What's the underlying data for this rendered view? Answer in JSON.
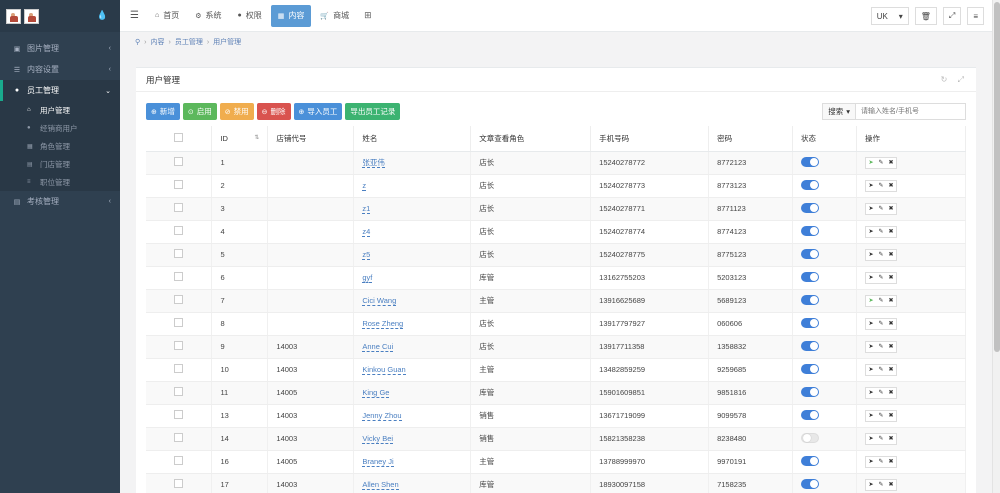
{
  "sidebar": {
    "items": [
      {
        "label": "图片管理",
        "icon": "image-icon"
      },
      {
        "label": "内容设置",
        "icon": "sliders-icon"
      },
      {
        "label": "员工管理",
        "icon": "user-icon"
      },
      {
        "label": "考核管理",
        "icon": "list-icon"
      }
    ],
    "sub_items": [
      {
        "label": "用户管理",
        "icon": "home-icon"
      },
      {
        "label": "经销商用户",
        "icon": "user-icon"
      },
      {
        "label": "角色管理",
        "icon": "th-icon"
      },
      {
        "label": "门店管理",
        "icon": "store-icon"
      },
      {
        "label": "职位管理",
        "icon": "list-icon"
      }
    ]
  },
  "topnav": {
    "tabs": [
      {
        "label": "首页",
        "icon": "home-icon"
      },
      {
        "label": "系统",
        "icon": "gear-icon"
      },
      {
        "label": "权限",
        "icon": "user-icon"
      },
      {
        "label": "内容",
        "icon": "table-icon"
      },
      {
        "label": "商城",
        "icon": "cart-icon"
      }
    ],
    "lang_label": "UK"
  },
  "breadcrumb": {
    "items": [
      "内容",
      "员工管理",
      "用户管理"
    ]
  },
  "panel": {
    "title": "用户管理"
  },
  "toolbar": {
    "add": "新增",
    "enable": "启用",
    "disable": "禁用",
    "delete": "删除",
    "import": "导入员工",
    "export": "导出员工记录"
  },
  "search": {
    "button": "搜索",
    "placeholder": "请输入姓名/手机号"
  },
  "table": {
    "columns": [
      "ID",
      "店铺代号",
      "姓名",
      "文章查看角色",
      "手机号码",
      "密码",
      "状态",
      "操作"
    ],
    "rows": [
      {
        "id": "1",
        "store": "",
        "name": "张亚伟",
        "role": "店长",
        "phone": "15240278772",
        "pwd": "8772123",
        "on": true,
        "send_active": true
      },
      {
        "id": "2",
        "store": "",
        "name": "z",
        "role": "店长",
        "phone": "15240278773",
        "pwd": "8773123",
        "on": true,
        "send_active": false
      },
      {
        "id": "3",
        "store": "",
        "name": "z1",
        "role": "店长",
        "phone": "15240278771",
        "pwd": "8771123",
        "on": true,
        "send_active": false
      },
      {
        "id": "4",
        "store": "",
        "name": "z4",
        "role": "店长",
        "phone": "15240278774",
        "pwd": "8774123",
        "on": true,
        "send_active": false
      },
      {
        "id": "5",
        "store": "",
        "name": "z5",
        "role": "店长",
        "phone": "15240278775",
        "pwd": "8775123",
        "on": true,
        "send_active": false
      },
      {
        "id": "6",
        "store": "",
        "name": "gyf",
        "role": "库管",
        "phone": "13162755203",
        "pwd": "5203123",
        "on": true,
        "send_active": false
      },
      {
        "id": "7",
        "store": "",
        "name": "Cici Wang",
        "role": "主管",
        "phone": "13916625689",
        "pwd": "5689123",
        "on": true,
        "send_active": true
      },
      {
        "id": "8",
        "store": "",
        "name": "Rose Zheng",
        "role": "店长",
        "phone": "13917797927",
        "pwd": "060606",
        "on": true,
        "send_active": false
      },
      {
        "id": "9",
        "store": "14003",
        "name": "Anne Cui",
        "role": "店长",
        "phone": "13917711358",
        "pwd": "1358832",
        "on": true,
        "send_active": false
      },
      {
        "id": "10",
        "store": "14003",
        "name": "Kinkou Guan",
        "role": "主管",
        "phone": "13482859259",
        "pwd": "9259685",
        "on": true,
        "send_active": false
      },
      {
        "id": "11",
        "store": "14005",
        "name": "King Ge",
        "role": "库管",
        "phone": "15901609851",
        "pwd": "9851816",
        "on": true,
        "send_active": false
      },
      {
        "id": "13",
        "store": "14003",
        "name": "Jenny Zhou",
        "role": "销售",
        "phone": "13671719099",
        "pwd": "9099578",
        "on": true,
        "send_active": false
      },
      {
        "id": "14",
        "store": "14003",
        "name": "Vicky Bei",
        "role": "销售",
        "phone": "15821358238",
        "pwd": "8238480",
        "on": false,
        "send_active": false
      },
      {
        "id": "16",
        "store": "14005",
        "name": "Braney Ji",
        "role": "主管",
        "phone": "13788999970",
        "pwd": "9970191",
        "on": true,
        "send_active": false
      },
      {
        "id": "17",
        "store": "14003",
        "name": "Allen Shen",
        "role": "库管",
        "phone": "18930097158",
        "pwd": "7158235",
        "on": true,
        "send_active": false
      }
    ]
  }
}
